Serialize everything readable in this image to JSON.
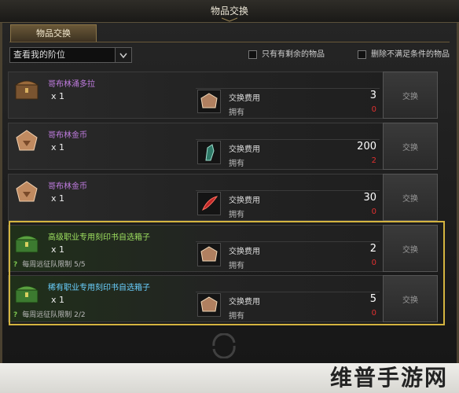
{
  "window": {
    "title": "物品交换"
  },
  "tab": {
    "label": "物品交换"
  },
  "filter": {
    "tier_select": "查看我的阶位",
    "only_remaining_label": "只有有剩余的物品",
    "hide_unmet_label": "删除不满足条件的物品"
  },
  "rows": [
    {
      "name": "哥布林涌多拉",
      "qty": "x 1",
      "limit": "",
      "cost_label": "交换费用",
      "own_label": "拥有",
      "cost": "3",
      "own": "0",
      "button": "交换"
    },
    {
      "name": "哥布林金币",
      "qty": "x 1",
      "limit": "",
      "cost_label": "交换费用",
      "own_label": "拥有",
      "cost": "200",
      "own": "2",
      "button": "交换"
    },
    {
      "name": "哥布林金币",
      "qty": "x 1",
      "limit": "",
      "cost_label": "交换费用",
      "own_label": "拥有",
      "cost": "30",
      "own": "0",
      "button": "交换"
    },
    {
      "name": "高级职业专用刻印书自选箱子",
      "qty": "x 1",
      "limit": "每周远征队限制 5/5",
      "cost_label": "交换费用",
      "own_label": "拥有",
      "cost": "2",
      "own": "0",
      "button": "交换"
    },
    {
      "name": "稀有职业专用刻印书自选箱子",
      "qty": "x 1",
      "limit": "每周远征队限制 2/2",
      "cost_label": "交换费用",
      "own_label": "拥有",
      "cost": "5",
      "own": "0",
      "button": "交换"
    }
  ],
  "watermark": "维普手游网",
  "colors": {
    "accent_gold": "#d4b440",
    "own_red": "#e03030"
  }
}
